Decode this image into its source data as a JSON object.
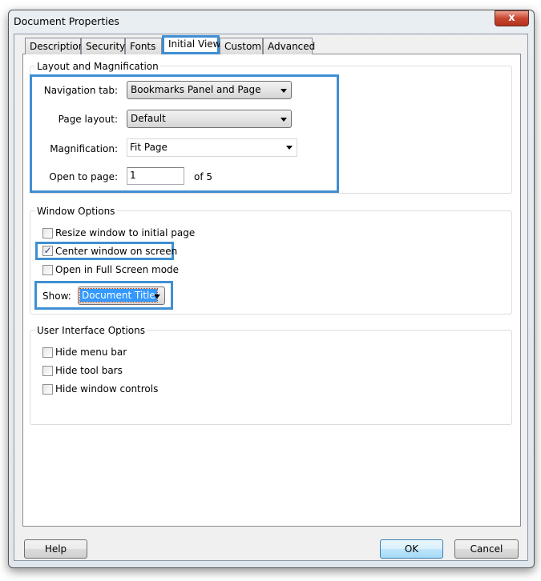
{
  "window": {
    "title": "Document Properties",
    "close_label": "x"
  },
  "tabs": [
    {
      "label": "Description"
    },
    {
      "label": "Security"
    },
    {
      "label": "Fonts"
    },
    {
      "label": "Initial View",
      "selected": true
    },
    {
      "label": "Custom"
    },
    {
      "label": "Advanced"
    }
  ],
  "layout": {
    "title": "Layout and Magnification",
    "navigation_tab": {
      "label": "Navigation tab:",
      "value": "Bookmarks Panel and Page"
    },
    "page_layout": {
      "label": "Page layout:",
      "value": "Default"
    },
    "magnification": {
      "label": "Magnification:",
      "value": "Fit Page"
    },
    "open_to_page": {
      "label": "Open to page:",
      "value": "1",
      "of": "of 5"
    }
  },
  "window_options": {
    "title": "Window Options",
    "resize": {
      "label": "Resize window to initial page",
      "checked": false
    },
    "center": {
      "label": "Center window on screen",
      "checked": true
    },
    "fullscreen": {
      "label": "Open in Full Screen mode",
      "checked": false
    },
    "show": {
      "label": "Show:",
      "value": "Document Title"
    }
  },
  "ui_options": {
    "title": "User Interface Options",
    "hide_menu": {
      "label": "Hide menu bar",
      "checked": false
    },
    "hide_toolbars": {
      "label": "Hide tool bars",
      "checked": false
    },
    "hide_controls": {
      "label": "Hide window controls",
      "checked": false
    }
  },
  "buttons": {
    "help": "Help",
    "ok": "OK",
    "cancel": "Cancel"
  },
  "colors": {
    "highlight": "#3f8fd2",
    "selection": "#3399ff"
  }
}
